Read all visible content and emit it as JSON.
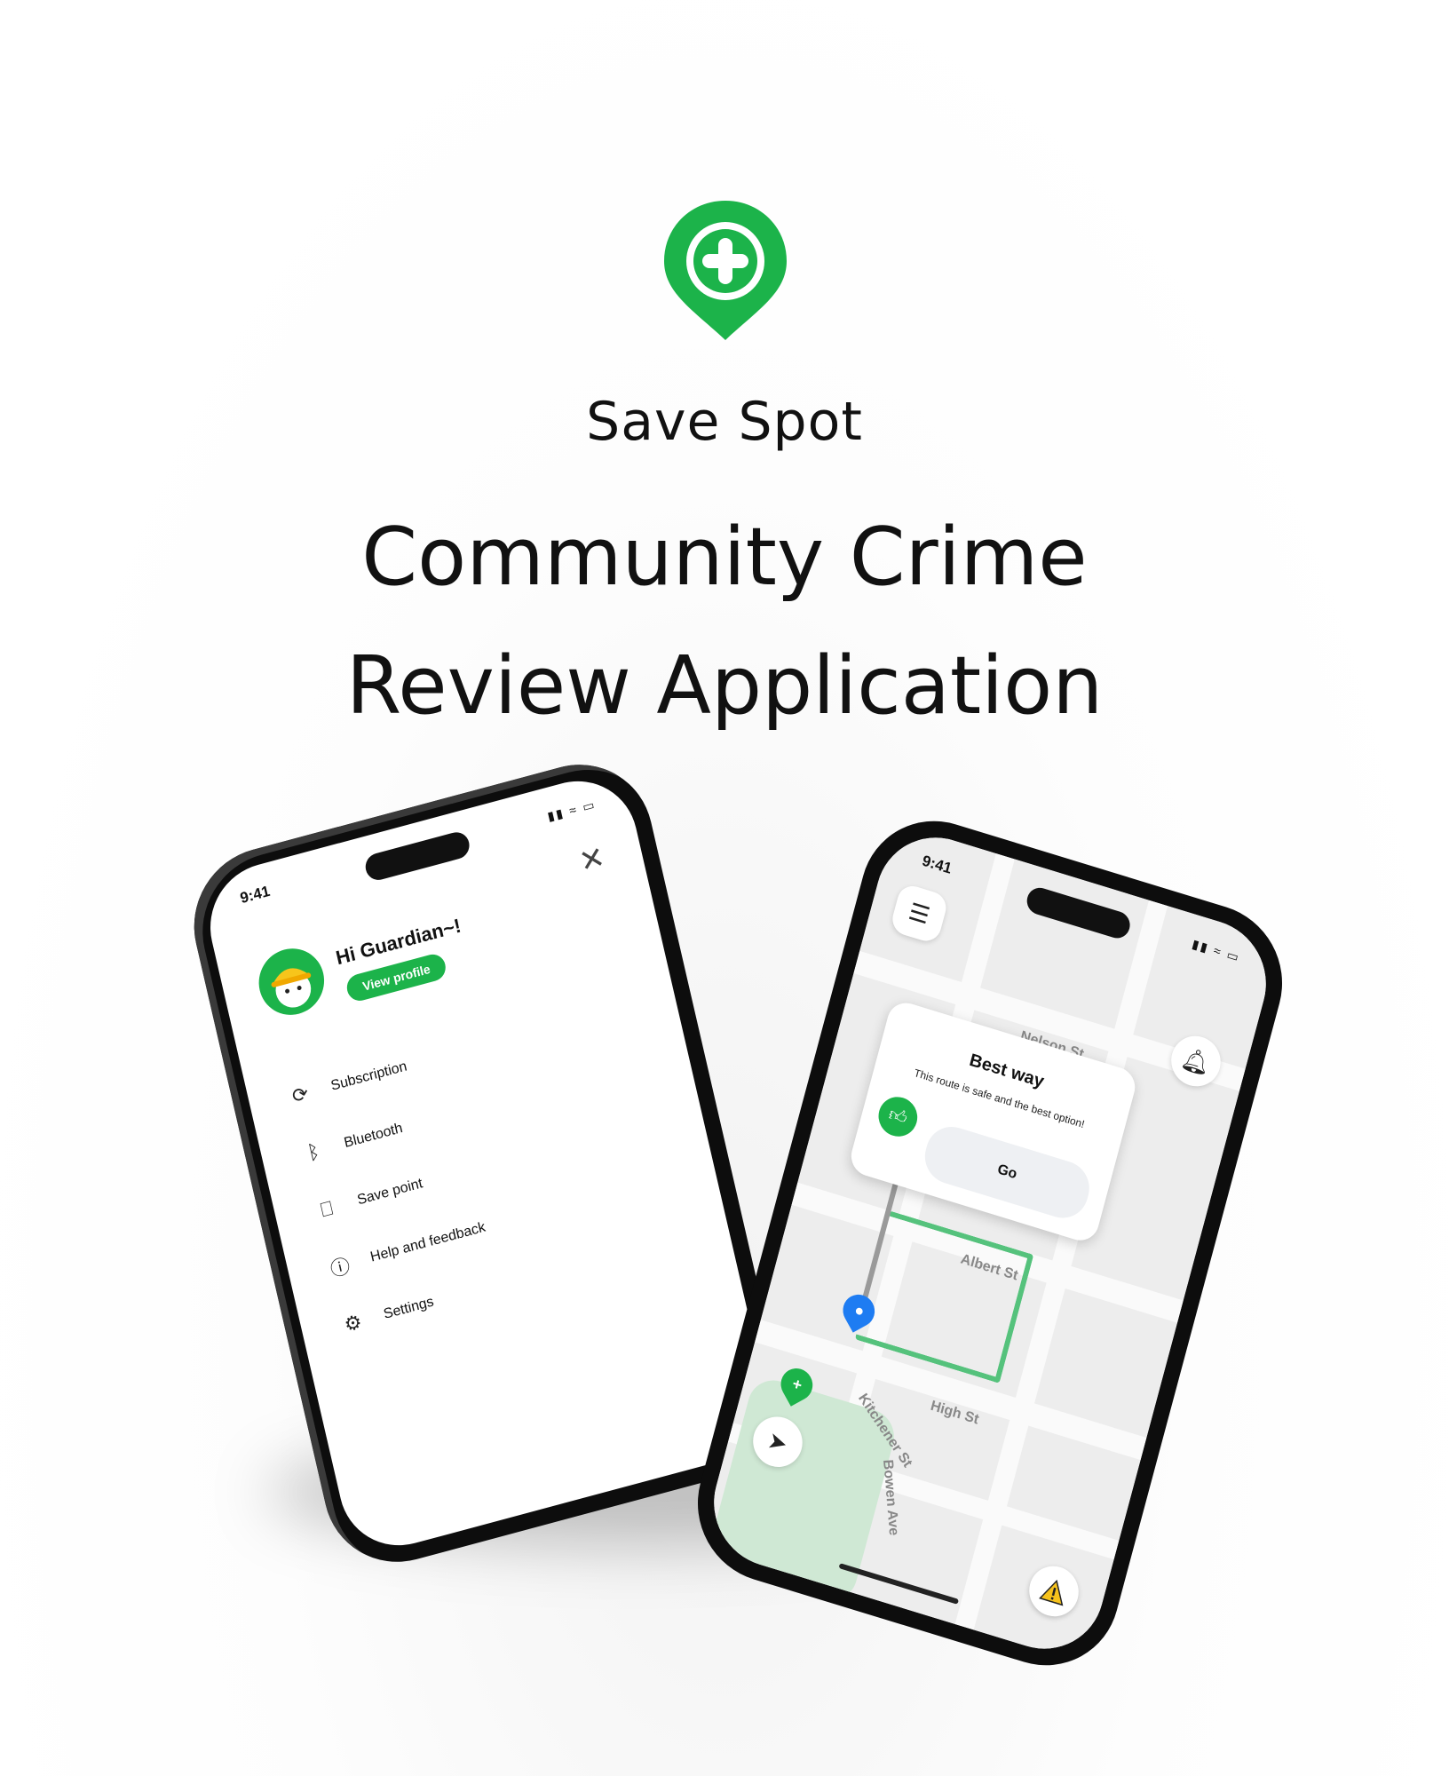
{
  "brand": {
    "name": "Save Spot",
    "logo_icon": "location-pin-plus-icon",
    "color": "#1cb34a"
  },
  "headline": {
    "line1": "Community Crime",
    "line2": "Review Application"
  },
  "left_phone": {
    "time": "9:41",
    "greeting": "Hi Guardian~!",
    "view_profile": "View profile",
    "menu": [
      {
        "icon": "subscription-icon",
        "label": "Subscription"
      },
      {
        "icon": "bluetooth-icon",
        "label": "Bluetooth"
      },
      {
        "icon": "bookmark-icon",
        "label": "Save point"
      },
      {
        "icon": "help-icon",
        "label": "Help and feedback"
      },
      {
        "icon": "settings-icon",
        "label": "Settings"
      }
    ]
  },
  "right_phone": {
    "time": "9:41",
    "card": {
      "title": "Best way",
      "subtitle": "This route is safe and the best option!",
      "go": "Go"
    },
    "streets": [
      "Nelson St",
      "Albert St",
      "High St",
      "Kitchener St",
      "Bowen Ave"
    ]
  }
}
